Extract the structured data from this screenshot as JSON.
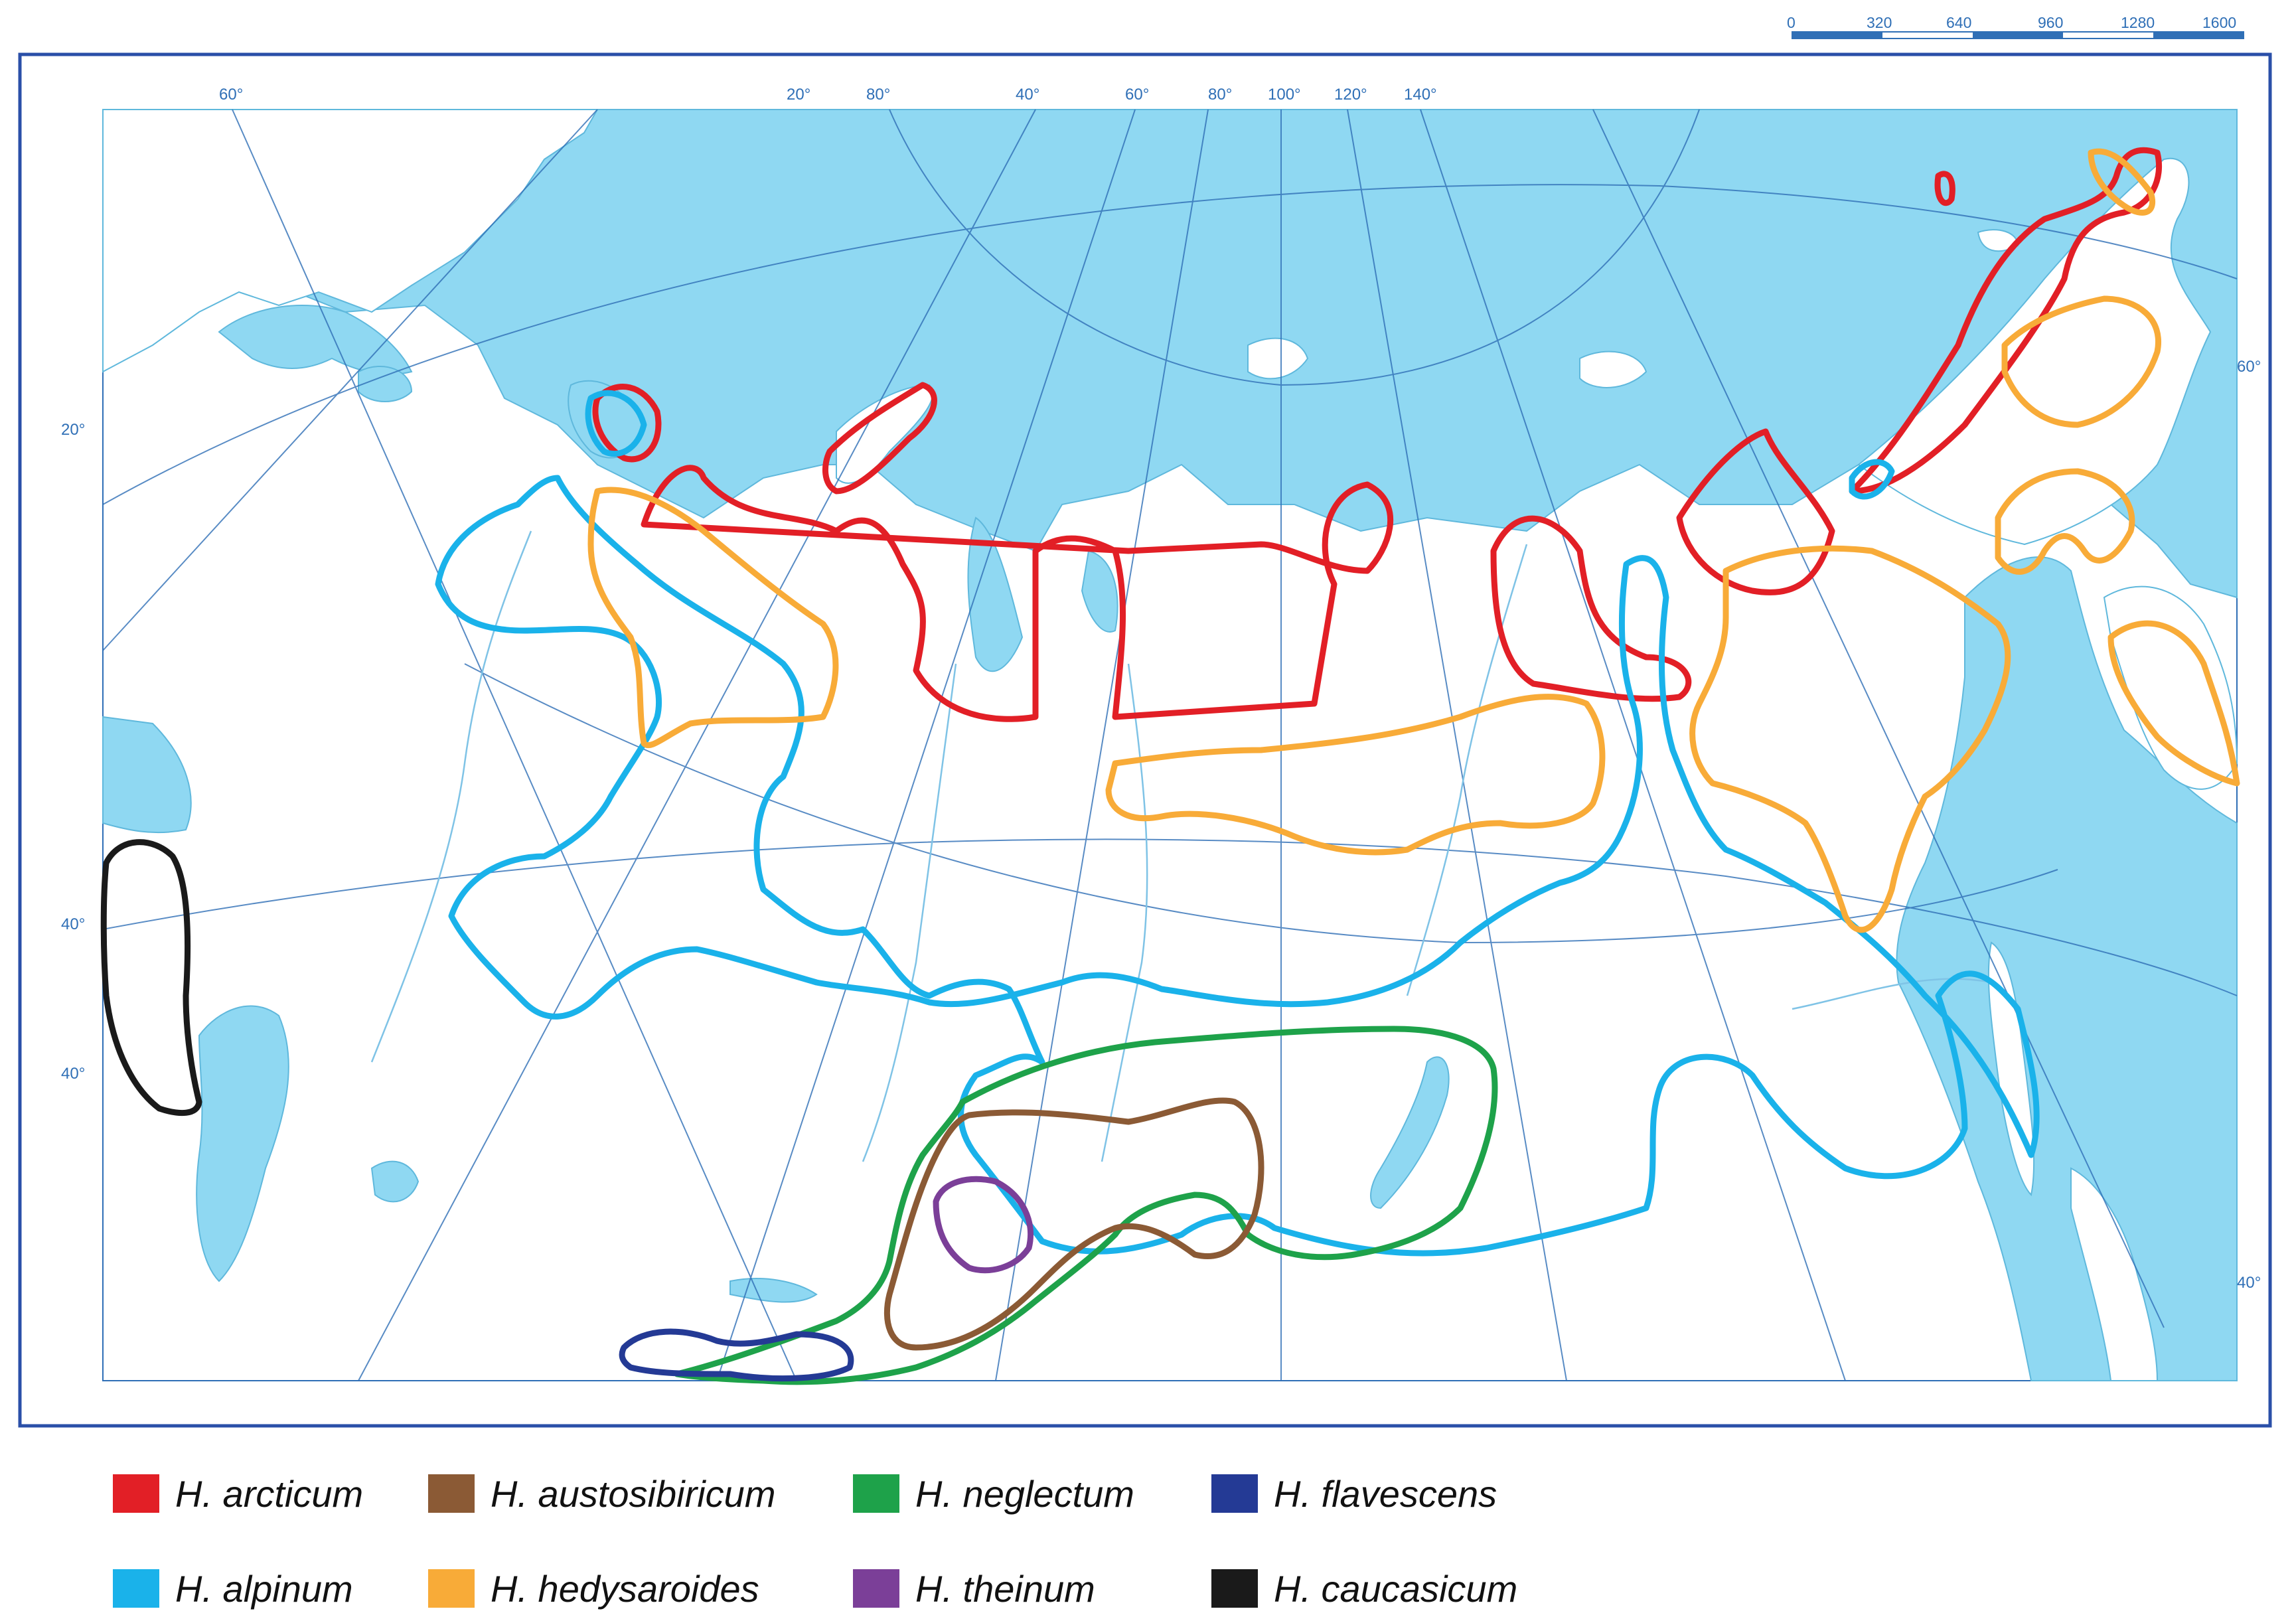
{
  "scale_bar": {
    "ticks": [
      "0",
      "320",
      "640",
      "960",
      "1280",
      "1600"
    ]
  },
  "coordinates": {
    "top": [
      "60°",
      "20°",
      "80°",
      "40°",
      "60°",
      "80°",
      "100°",
      "120°",
      "140°"
    ],
    "left": [
      "20°",
      "40°",
      "40°"
    ],
    "right": [
      "60°",
      "40°"
    ]
  },
  "colors": {
    "water": "#8fd8f2",
    "land": "#ffffff",
    "grid": "#2f6fb6",
    "frame": "#2a4fa8"
  },
  "legend": [
    {
      "label": "H. arcticum",
      "color": "#e21f26"
    },
    {
      "label": "H. austosibiricum",
      "color": "#8b5a35"
    },
    {
      "label": "H. neglectum",
      "color": "#1ea24a"
    },
    {
      "label": "H. flavescens",
      "color": "#243a95"
    },
    {
      "label": "H. alpinum",
      "color": "#1ab2ea"
    },
    {
      "label": "H. hedysaroides",
      "color": "#f8ab38"
    },
    {
      "label": "H. theinum",
      "color": "#7b3f98"
    },
    {
      "label": "H. caucasicum",
      "color": "#1a1a1a"
    }
  ]
}
